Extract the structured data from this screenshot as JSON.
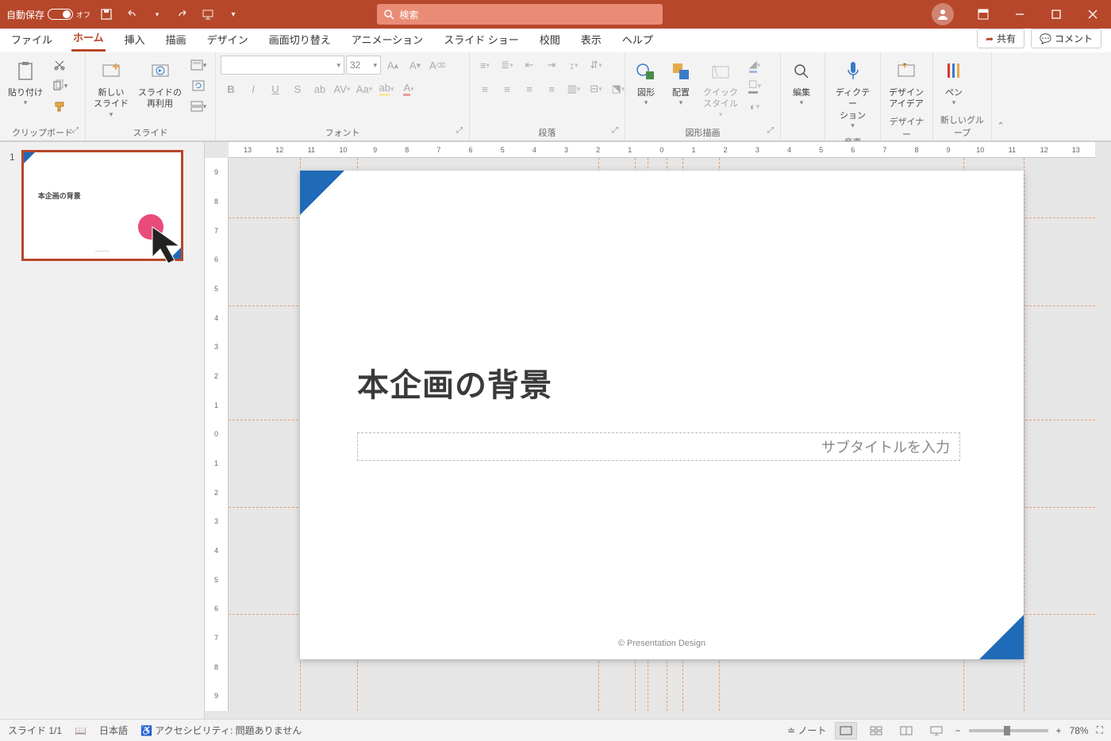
{
  "titlebar": {
    "autosave_label": "自動保存",
    "autosave_state": "オフ",
    "search_placeholder": "検索"
  },
  "tabs": {
    "file": "ファイル",
    "home": "ホーム",
    "insert": "挿入",
    "draw": "描画",
    "design": "デザイン",
    "transitions": "画面切り替え",
    "animations": "アニメーション",
    "slideshow": "スライド ショー",
    "review": "校閲",
    "view": "表示",
    "help": "ヘルプ",
    "share": "共有",
    "comment": "コメント"
  },
  "ribbon": {
    "clipboard": {
      "paste": "貼り付け",
      "label": "クリップボード"
    },
    "slides": {
      "new_slide": "新しい\nスライド",
      "reuse": "スライドの\n再利用",
      "label": "スライド"
    },
    "font": {
      "size": "32",
      "label": "フォント"
    },
    "paragraph": {
      "label": "段落"
    },
    "drawing": {
      "shapes": "図形",
      "arrange": "配置",
      "quick_styles": "クイック\nスタイル",
      "label": "図形描画"
    },
    "editing": {
      "label": "編集"
    },
    "voice": {
      "dictate": "ディクテー\nション",
      "label": "音声"
    },
    "designer": {
      "ideas": "デザイン\nアイデア",
      "label": "デザイナー"
    },
    "newgroup": {
      "pen": "ペン",
      "label": "新しいグループ"
    }
  },
  "thumbs": {
    "num1": "1",
    "title": "本企画の背景"
  },
  "slide": {
    "title": "本企画の背景",
    "subtitle_placeholder": "サブタイトルを入力",
    "footer": "© Presentation Design"
  },
  "ruler_h": [
    "13",
    "12",
    "11",
    "10",
    "9",
    "8",
    "7",
    "6",
    "5",
    "4",
    "3",
    "2",
    "1",
    "0",
    "1",
    "2",
    "3",
    "4",
    "5",
    "6",
    "7",
    "8",
    "9",
    "10",
    "11",
    "12",
    "13"
  ],
  "ruler_v": [
    "9",
    "8",
    "7",
    "6",
    "5",
    "4",
    "3",
    "2",
    "1",
    "0",
    "1",
    "2",
    "3",
    "4",
    "5",
    "6",
    "7",
    "8",
    "9"
  ],
  "status": {
    "slide": "スライド 1/1",
    "lang": "日本語",
    "a11y": "アクセシビリティ: 問題ありません",
    "notes": "ノート",
    "zoom": "78%"
  }
}
